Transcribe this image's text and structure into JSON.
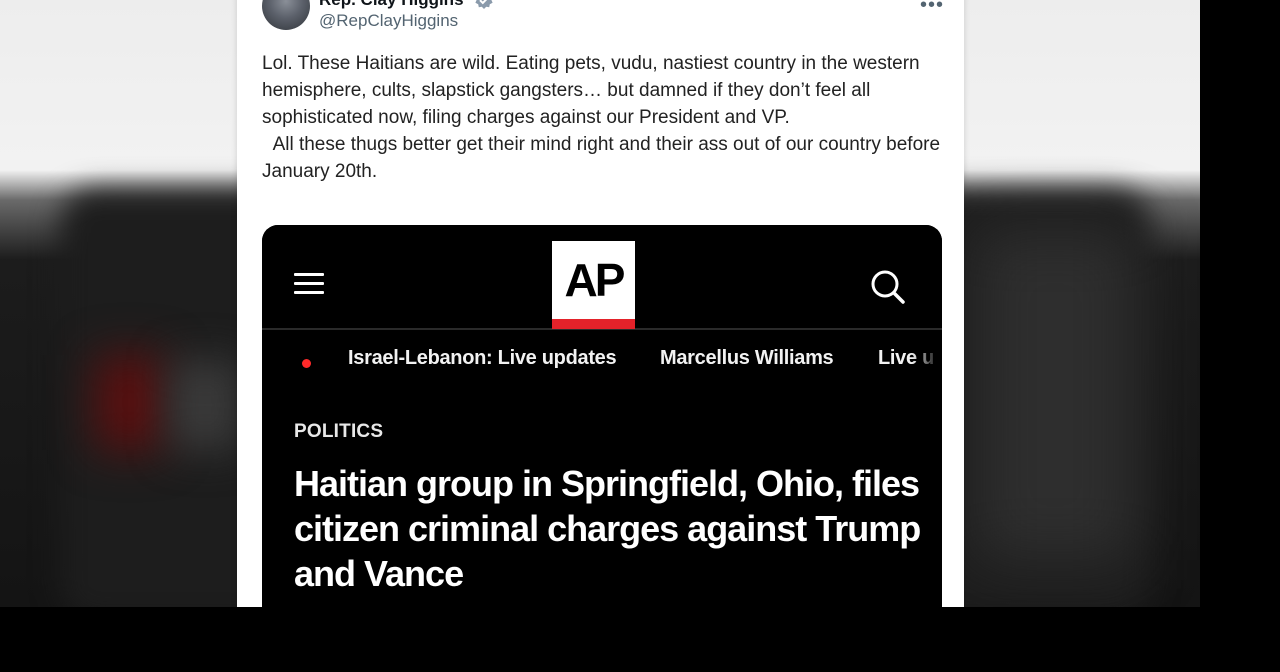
{
  "tweet": {
    "display_name": "Rep. Clay Higgins",
    "handle": "@RepClayHiggins",
    "text": "Lol. These Haitians are wild. Eating pets, vudu, nastiest country in the western hemisphere, cults, slapstick gangsters… but damned if they don’t feel all sophisticated now, filing charges against our President and VP.\n  All these thugs better get their mind right and their ass out of our country before January 20th."
  },
  "ap_card": {
    "logo_text": "AP",
    "nav_items": [
      "Israel-Lebanon: Live updates",
      "Marcellus Williams",
      "Live u"
    ],
    "section": "POLITICS",
    "headline": "Haitian group in Springfield, Ohio, files citizen criminal charges against Trump and Vance"
  },
  "colors": {
    "ap_red": "#e3222a",
    "verified_blue": "#8a9aab",
    "live_dot": "#ff2a2a"
  },
  "icons": [
    "menu-icon",
    "search-icon",
    "verified-badge-icon",
    "more-icon",
    "live-dot-icon"
  ]
}
